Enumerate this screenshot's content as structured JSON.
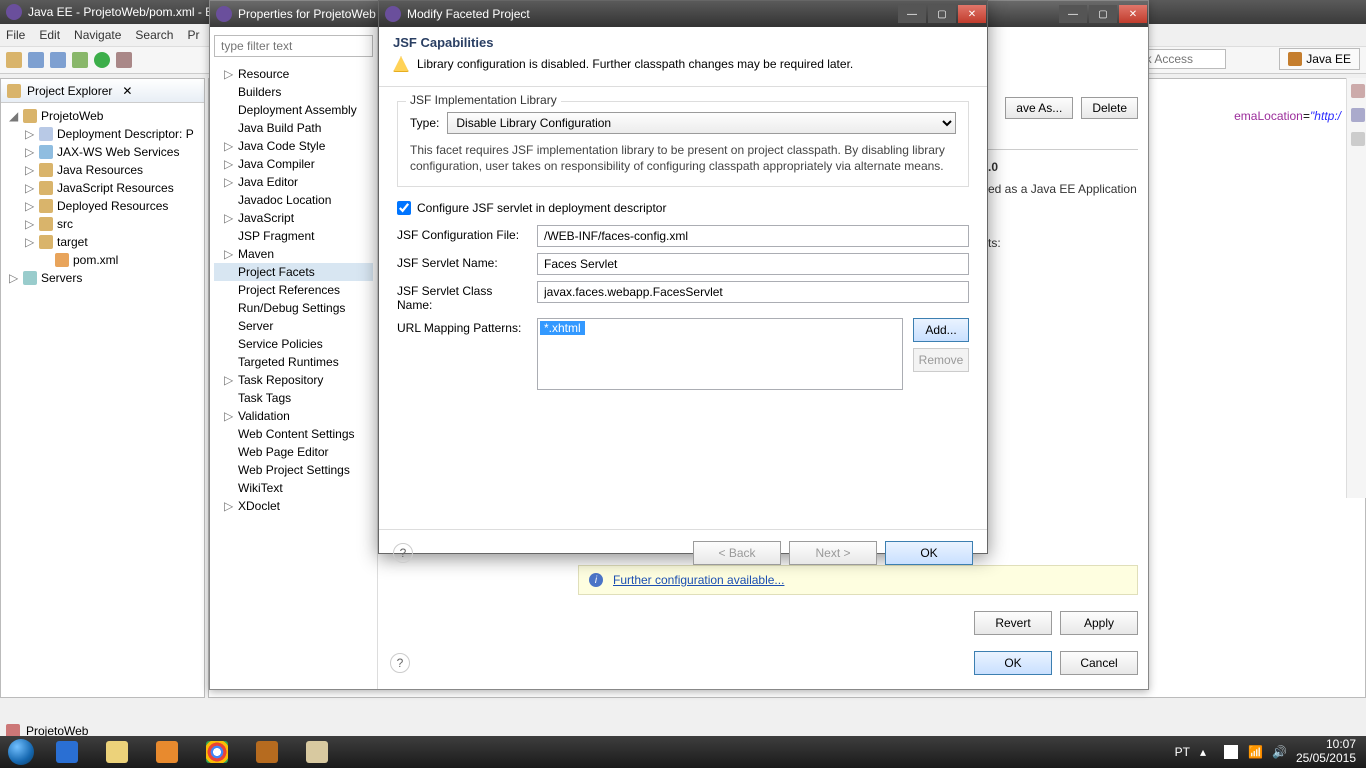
{
  "eclipse": {
    "title": "Java EE - ProjetoWeb/pom.xml - E",
    "menu": [
      "File",
      "Edit",
      "Navigate",
      "Search",
      "Pr"
    ],
    "quick_access_placeholder": "Quick Access",
    "perspective": "Java EE"
  },
  "project_explorer": {
    "title": "Project Explorer",
    "tree": {
      "root": "ProjetoWeb",
      "children": [
        "Deployment Descriptor: P",
        "JAX-WS Web Services",
        "Java Resources",
        "JavaScript Resources",
        "Deployed Resources",
        "src",
        "target",
        "pom.xml"
      ],
      "servers": "Servers"
    }
  },
  "editor": {
    "snippet_attr": "emaLocation",
    "snippet_val": "\"http:/"
  },
  "properties": {
    "title": "Properties for ProjetoWeb",
    "filter_placeholder": "type filter text",
    "tree": [
      {
        "label": "Resource",
        "arrow": true
      },
      {
        "label": "Builders"
      },
      {
        "label": "Deployment Assembly"
      },
      {
        "label": "Java Build Path"
      },
      {
        "label": "Java Code Style",
        "arrow": true
      },
      {
        "label": "Java Compiler",
        "arrow": true
      },
      {
        "label": "Java Editor",
        "arrow": true
      },
      {
        "label": "Javadoc Location"
      },
      {
        "label": "JavaScript",
        "arrow": true
      },
      {
        "label": "JSP Fragment"
      },
      {
        "label": "Maven",
        "arrow": true
      },
      {
        "label": "Project Facets",
        "selected": true
      },
      {
        "label": "Project References"
      },
      {
        "label": "Run/Debug Settings"
      },
      {
        "label": "Server"
      },
      {
        "label": "Service Policies"
      },
      {
        "label": "Targeted Runtimes"
      },
      {
        "label": "Task Repository",
        "arrow": true
      },
      {
        "label": "Task Tags"
      },
      {
        "label": "Validation",
        "arrow": true
      },
      {
        "label": "Web Content Settings"
      },
      {
        "label": "Web Page Editor"
      },
      {
        "label": "Web Project Settings"
      },
      {
        "label": "WikiText"
      },
      {
        "label": "XDoclet",
        "arrow": true
      }
    ],
    "save_as": "ave As...",
    "delete": "Delete",
    "details_version": ".0",
    "details_text": "ed as a Java EE Application",
    "details_tab": "ts:",
    "further_link": "Further configuration available...",
    "revert": "Revert",
    "apply": "Apply",
    "ok": "OK",
    "cancel": "Cancel"
  },
  "facet": {
    "title": "Modify Faceted Project",
    "header_title": "JSF Capabilities",
    "header_warning": "Library configuration is disabled. Further classpath changes may be required later.",
    "group_legend": "JSF Implementation Library",
    "type_label": "Type:",
    "type_value": "Disable Library Configuration",
    "note": "This facet requires JSF implementation library to be present on project classpath. By disabling library configuration, user takes on responsibility of configuring classpath appropriately via alternate means.",
    "configure_servlet_label": "Configure JSF servlet in deployment descriptor",
    "config_file_label": "JSF Configuration File:",
    "config_file_value": "/WEB-INF/faces-config.xml",
    "servlet_name_label": "JSF Servlet Name:",
    "servlet_name_value": "Faces Servlet",
    "servlet_class_label": "JSF Servlet Class Name:",
    "servlet_class_value": "javax.faces.webapp.FacesServlet",
    "patterns_label": "URL Mapping Patterns:",
    "patterns_item": "*.xhtml",
    "add": "Add...",
    "remove": "Remove",
    "back": "< Back",
    "next": "Next >",
    "ok": "OK"
  },
  "status": {
    "project": "ProjetoWeb"
  },
  "taskbar": {
    "lang": "PT",
    "time": "10:07",
    "date": "25/05/2015"
  }
}
